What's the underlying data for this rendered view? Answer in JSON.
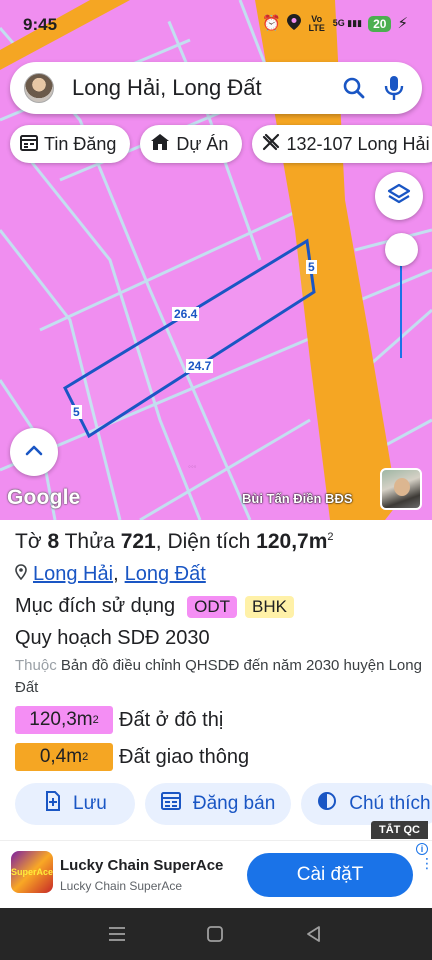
{
  "status_bar": {
    "time": "9:45",
    "network": "Vo LTE",
    "signal": "5G",
    "battery": "20"
  },
  "search": {
    "query": "Long Hải, Long Đất"
  },
  "chips": [
    {
      "label": "Tin Đăng",
      "icon": "calendar-icon"
    },
    {
      "label": "Dự Án",
      "icon": "house-icon"
    },
    {
      "label": "132-107 Long Hải",
      "icon": "ruler-icon"
    }
  ],
  "map": {
    "dimensions": [
      "5",
      "26.4",
      "24.7",
      "5"
    ],
    "google_logo": "Google",
    "author": "Bùi Tấn Điền BĐS",
    "colors": {
      "residential": "#f08ef0",
      "road": "#f5a623",
      "parcel_outline": "#1a56c4"
    }
  },
  "panel": {
    "title": {
      "to_label": "Tờ",
      "to_value": "8",
      "thua_label": "Thửa",
      "thua_value": "721",
      "area_label": "Diện tích",
      "area_value": "120,7m",
      "area_unit_sup": "2"
    },
    "location": {
      "ward": "Long Hải",
      "separator": ",",
      "district": "Long Đất"
    },
    "purpose": {
      "label": "Mục đích sử dụng",
      "tags": [
        {
          "code": "ODT",
          "color": "#f48ef4"
        },
        {
          "code": "BHK",
          "color": "#fff1a8"
        }
      ]
    },
    "plan": {
      "title": "Quy hoạch SDĐ 2030",
      "desc_prefix": "Thuộc",
      "desc": "Bản đồ điều chỉnh QHSDĐ đến năm 2030 huyện Long Đất"
    },
    "areas": [
      {
        "value": "120,3m",
        "sup": "2",
        "label": "Đất ở đô thị",
        "color": "#f48ef4"
      },
      {
        "value": "0,4m",
        "sup": "2",
        "label": "Đất giao thông",
        "color": "#f5a623"
      }
    ],
    "actions": [
      {
        "label": "Lưu",
        "icon": "bookmark-add-icon"
      },
      {
        "label": "Đăng bán",
        "icon": "listing-icon"
      },
      {
        "label": "Chú thích",
        "icon": "legend-icon"
      }
    ]
  },
  "ad": {
    "close_label": "TẮT QC",
    "logo_text": "SuperAce",
    "title": "Lucky Chain SuperAce",
    "subtitle": "Lucky Chain SuperAce",
    "cta": "Cài đặT"
  }
}
